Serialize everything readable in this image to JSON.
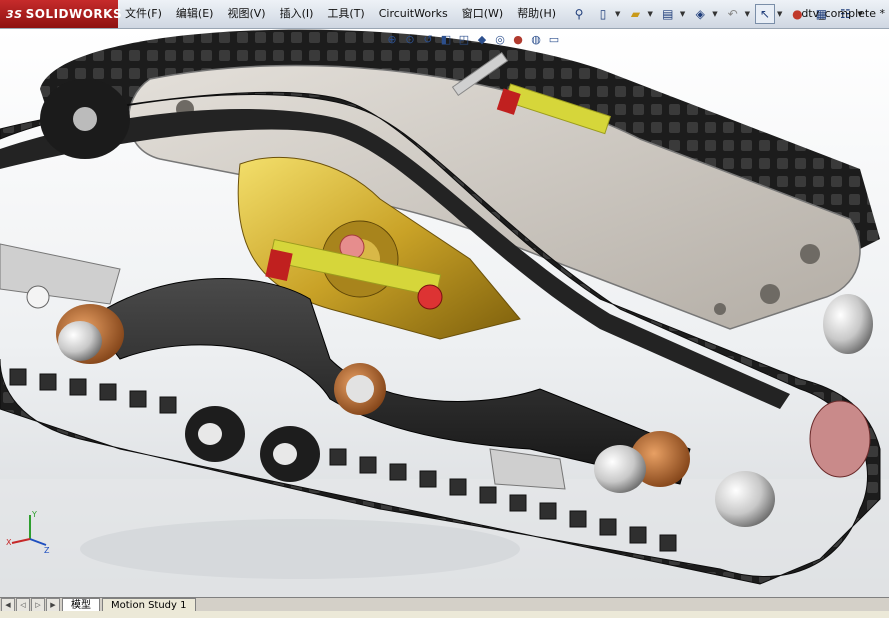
{
  "app": {
    "brand": "SOLIDWORKS",
    "brand_prefix": "3S"
  },
  "menu": [
    {
      "label": "文件(F)"
    },
    {
      "label": "编辑(E)"
    },
    {
      "label": "视图(V)"
    },
    {
      "label": "插入(I)"
    },
    {
      "label": "工具(T)"
    },
    {
      "label": "CircuitWorks"
    },
    {
      "label": "窗口(W)"
    },
    {
      "label": "帮助(H)"
    }
  ],
  "document": {
    "title": "dtv_complete *"
  },
  "toolbar_icons": [
    "pin-icon",
    "new-document-icon",
    "open-folder-icon",
    "print-icon",
    "paint-icon",
    "undo-icon",
    "select-cursor-icon",
    "traffic-light-icon",
    "options-icon",
    "file-properties-icon"
  ],
  "heads_up_icons": [
    "zoom-to-fit-icon",
    "zoom-area-icon",
    "previous-view-icon",
    "section-view-icon",
    "view-orientation-icon",
    "display-style-icon",
    "hide-show-icon",
    "appearance-icon",
    "scene-icon",
    "monitor-icon"
  ],
  "tabs": [
    {
      "label": "模型",
      "active": true
    },
    {
      "label": "Motion Study 1",
      "active": false
    }
  ],
  "triad": {
    "x": "X",
    "y": "Y",
    "z": "Z"
  },
  "colors": {
    "brand_red": "#b71c1c",
    "track": "#1f1f1f",
    "plate": "#c9c4bd",
    "gear_gold": "#c9a227",
    "spring_yellow": "#d6d63a",
    "bushing_copper": "#b5652b"
  }
}
